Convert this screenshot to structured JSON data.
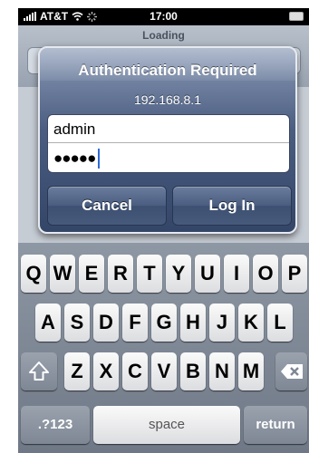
{
  "status": {
    "carrier": "AT&T",
    "time": "17:00"
  },
  "browser": {
    "loading": "Loading"
  },
  "dialog": {
    "title": "Authentication Required",
    "host": "192.168.8.1",
    "username_value": "admin",
    "password_mask": "●●●●●",
    "cancel_label": "Cancel",
    "login_label": "Log In"
  },
  "keyboard": {
    "row1": [
      "Q",
      "W",
      "E",
      "R",
      "T",
      "Y",
      "U",
      "I",
      "O",
      "P"
    ],
    "row2": [
      "A",
      "S",
      "D",
      "F",
      "G",
      "H",
      "J",
      "K",
      "L"
    ],
    "row3": [
      "Z",
      "X",
      "C",
      "V",
      "B",
      "N",
      "M"
    ],
    "numbers_label": ".?123",
    "space_label": "space",
    "return_label": "return"
  },
  "icons": [
    "signal-icon",
    "wifi-icon",
    "activity-spinner-icon",
    "battery-icon",
    "shift-icon",
    "delete-icon"
  ]
}
